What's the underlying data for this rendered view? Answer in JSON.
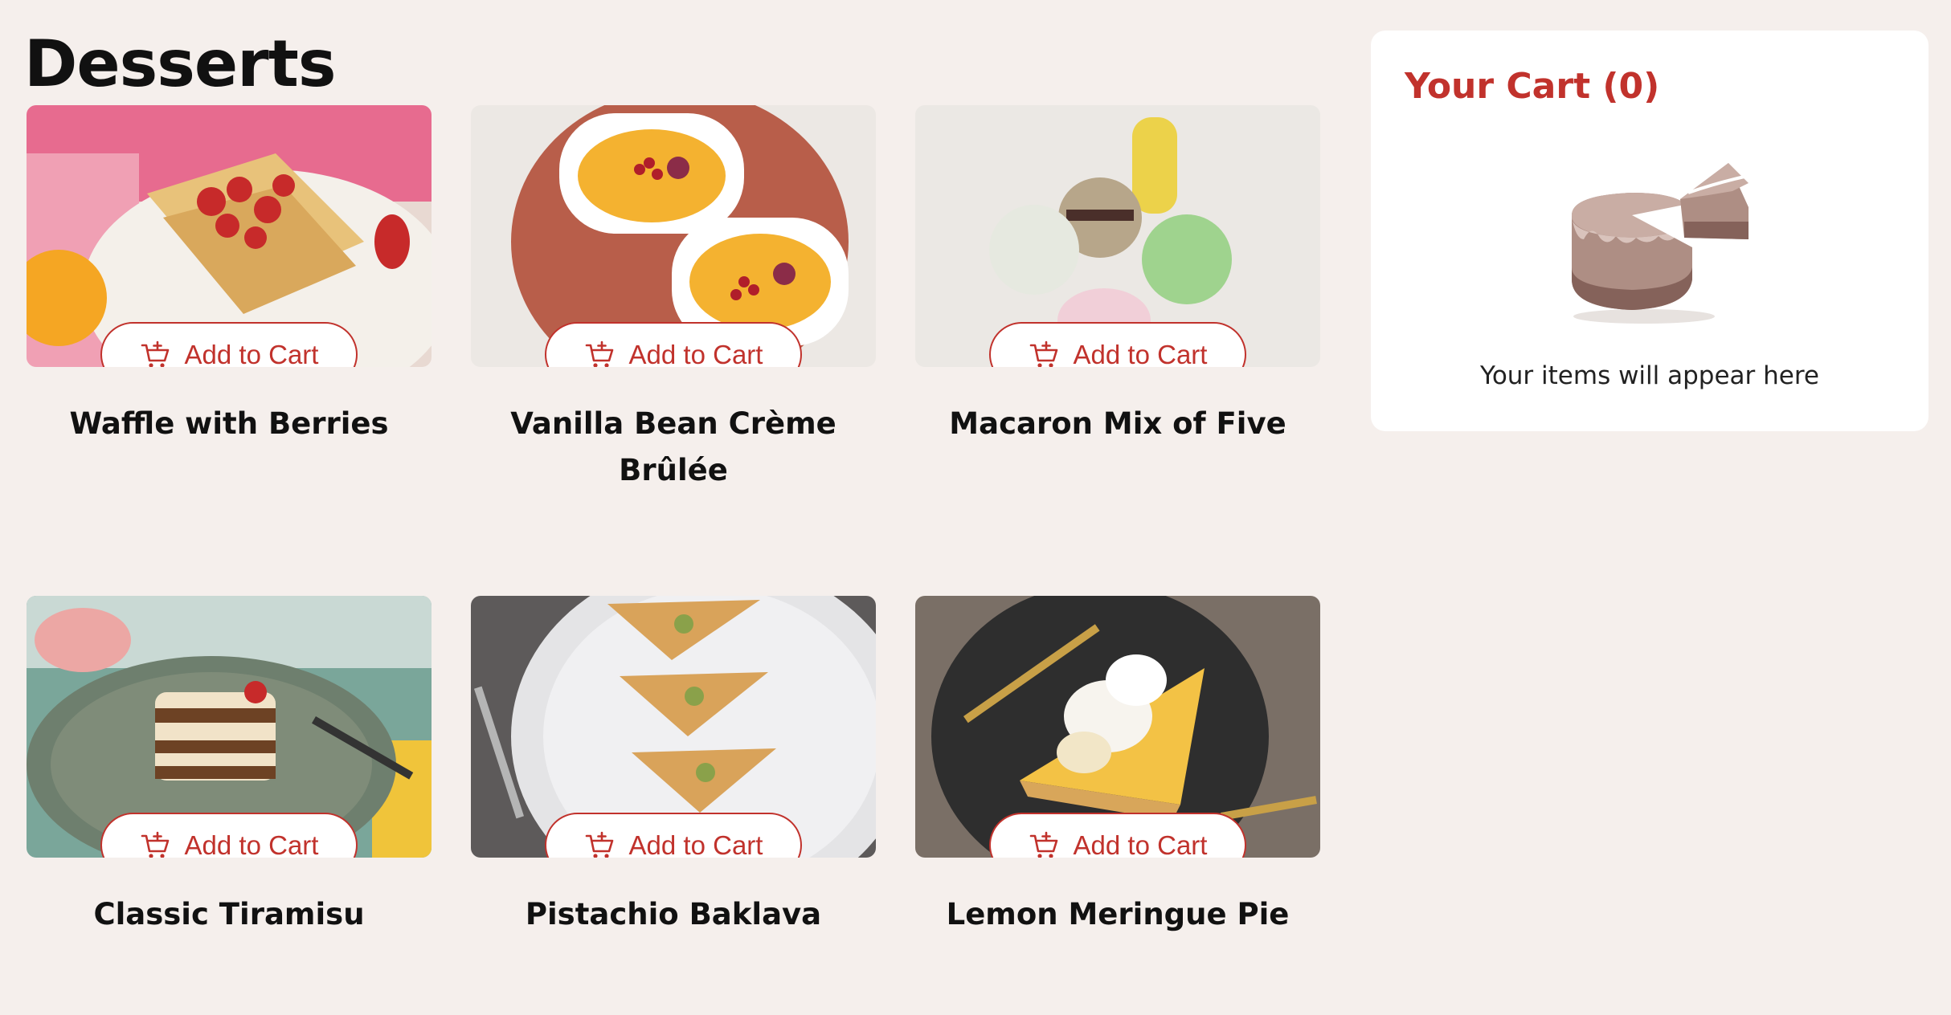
{
  "page": {
    "title": "Desserts"
  },
  "products": [
    {
      "name": "Waffle with Berries",
      "button_label": "Add to Cart"
    },
    {
      "name": "Vanilla Bean Crème Brûlée",
      "button_label": "Add to Cart"
    },
    {
      "name": "Macaron Mix of Five",
      "button_label": "Add to Cart"
    },
    {
      "name": "Classic Tiramisu",
      "button_label": "Add to Cart"
    },
    {
      "name": "Pistachio Baklava",
      "button_label": "Add to Cart"
    },
    {
      "name": "Lemon Meringue Pie",
      "button_label": "Add to Cart"
    }
  ],
  "cart": {
    "title": "Your Cart (0)",
    "empty_message": "Your items will appear here"
  },
  "colors": {
    "accent": "#c1322c",
    "background": "#f5efec",
    "cart_panel": "#ffffff"
  },
  "icons": {
    "button": "cart-plus-icon",
    "empty_cart": "cake-illustration"
  }
}
